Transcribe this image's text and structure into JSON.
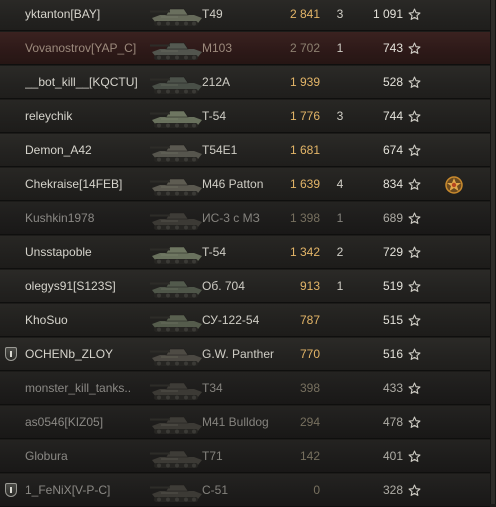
{
  "colors": {
    "damage": "#e3b568",
    "name": "#d6d4cc",
    "row_bg": "#232220",
    "self_row_bg": "#2d1918"
  },
  "players": [
    {
      "name": "yktanton[BAY]",
      "tank": "T49",
      "damage": "2 841",
      "kills": "3",
      "xp": "1 091",
      "state": "alive",
      "platoon": false,
      "medal": false,
      "tank_color": "#6a6f5e",
      "tank_icon": "light-tank-icon"
    },
    {
      "name": "Vovanostrov[YAP_C]",
      "tank": "M103",
      "damage": "2 702",
      "kills": "1",
      "xp": "743",
      "state": "self",
      "platoon": false,
      "medal": false,
      "tank_color": "#545951",
      "tank_icon": "heavy-tank-icon"
    },
    {
      "name": "__bot_kill__[KQCTU]",
      "tank": "212A",
      "damage": "1 939",
      "kills": "",
      "xp": "528",
      "state": "alive",
      "platoon": false,
      "medal": false,
      "tank_color": "#4c524a",
      "tank_icon": "spg-icon"
    },
    {
      "name": "releychik",
      "tank": "T-54",
      "damage": "1 776",
      "kills": "3",
      "xp": "744",
      "state": "alive",
      "platoon": false,
      "medal": false,
      "tank_color": "#6e7661",
      "tank_icon": "medium-tank-icon"
    },
    {
      "name": "Demon_A42",
      "tank": "T54E1",
      "damage": "1 681",
      "kills": "",
      "xp": "674",
      "state": "alive",
      "platoon": false,
      "medal": false,
      "tank_color": "#5a5850",
      "tank_icon": "medium-tank-icon"
    },
    {
      "name": "Chekraise[14FEB]",
      "tank": "M46 Patton",
      "damage": "1 639",
      "kills": "4",
      "xp": "834",
      "state": "alive",
      "platoon": false,
      "medal": true,
      "tank_color": "#5e5c52",
      "tank_icon": "medium-tank-icon"
    },
    {
      "name": "Kushkin1978",
      "tank": "ИС-3 с МЗ",
      "damage": "1 398",
      "kills": "1",
      "xp": "689",
      "state": "dead",
      "platoon": false,
      "medal": false,
      "tank_color": "#3e3c37",
      "tank_icon": "heavy-tank-icon"
    },
    {
      "name": "Unsstapoble",
      "tank": "T-54",
      "damage": "1 342",
      "kills": "2",
      "xp": "729",
      "state": "alive",
      "platoon": false,
      "medal": false,
      "tank_color": "#6e7661",
      "tank_icon": "medium-tank-icon"
    },
    {
      "name": "olegys91[S123S]",
      "tank": "Об. 704",
      "damage": "913",
      "kills": "1",
      "xp": "519",
      "state": "alive",
      "platoon": false,
      "medal": false,
      "tank_color": "#525a4c",
      "tank_icon": "tank-destroyer-icon"
    },
    {
      "name": "KhoSuo",
      "tank": "СУ-122-54",
      "damage": "787",
      "kills": "",
      "xp": "515",
      "state": "alive",
      "platoon": false,
      "medal": false,
      "tank_color": "#59604f",
      "tank_icon": "tank-destroyer-icon"
    },
    {
      "name": "OCHENb_ZLOY",
      "tank": "G.W. Panther",
      "damage": "770",
      "kills": "",
      "xp": "516",
      "state": "alive",
      "platoon": true,
      "medal": false,
      "tank_color": "#4e4b44",
      "tank_icon": "spg-icon"
    },
    {
      "name": "monster_kill_tanks..",
      "tank": "T34",
      "damage": "398",
      "kills": "",
      "xp": "433",
      "state": "dead",
      "platoon": false,
      "medal": false,
      "tank_color": "#3e3c37",
      "tank_icon": "heavy-tank-icon"
    },
    {
      "name": "as0546[KIZ05]",
      "tank": "M41 Bulldog",
      "damage": "294",
      "kills": "",
      "xp": "478",
      "state": "dead",
      "platoon": false,
      "medal": false,
      "tank_color": "#3e3c37",
      "tank_icon": "light-tank-icon"
    },
    {
      "name": "Globura",
      "tank": "T71",
      "damage": "142",
      "kills": "",
      "xp": "401",
      "state": "dead",
      "platoon": false,
      "medal": false,
      "tank_color": "#3e3c37",
      "tank_icon": "light-tank-icon"
    },
    {
      "name": "1_FeNiX[V-P-C]",
      "tank": "С-51",
      "damage": "0",
      "kills": "",
      "xp": "328",
      "state": "dead",
      "platoon": true,
      "medal": false,
      "tank_color": "#3e3c37",
      "tank_icon": "spg-icon"
    }
  ]
}
